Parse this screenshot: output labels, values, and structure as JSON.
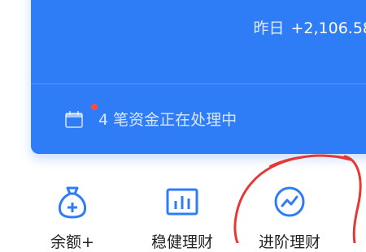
{
  "summary": {
    "yesterday_label": "昨日",
    "yesterday_value": "+2,106.58"
  },
  "notice": {
    "count": "4",
    "text": "笔资金正在处理中"
  },
  "nav": {
    "items": [
      {
        "label": "余额+",
        "icon": "money-bag-icon"
      },
      {
        "label": "稳健理财",
        "icon": "bar-chart-icon"
      },
      {
        "label": "进阶理财",
        "icon": "trend-chart-icon"
      }
    ]
  },
  "colors": {
    "card_blue": "#2e7cf6",
    "icon_blue": "#2e7cf6",
    "annotation_red": "#e53935"
  }
}
